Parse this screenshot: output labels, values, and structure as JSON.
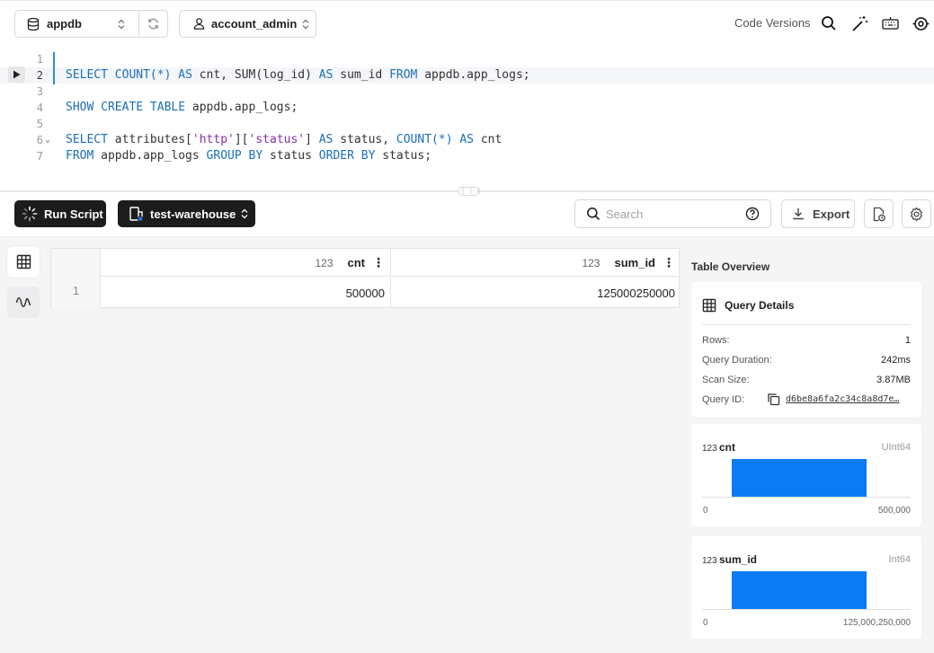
{
  "toolbar": {
    "database": "appdb",
    "user": "account_admin",
    "code_versions": "Code Versions"
  },
  "editor": {
    "lines": [
      {
        "num": "1"
      },
      {
        "num": "2"
      },
      {
        "num": "3"
      },
      {
        "num": "4"
      },
      {
        "num": "5"
      },
      {
        "num": "6"
      },
      {
        "num": "7"
      }
    ],
    "tokens": {
      "l2": [
        "SELECT",
        " COUNT(*) ",
        "AS",
        " cnt, SUM(log_id) ",
        "AS",
        " sum_id ",
        "FROM",
        " appdb.app_logs;"
      ],
      "l4": [
        "SHOW CREATE TABLE",
        " appdb.app_logs;"
      ],
      "l6": [
        "SELECT",
        " attributes[",
        "'http'",
        "][",
        "'status'",
        "] ",
        "AS",
        " status, ",
        "COUNT(*)",
        " ",
        "AS",
        " cnt"
      ],
      "l7": [
        "FROM",
        " appdb.app_logs ",
        "GROUP BY",
        " status ",
        "ORDER BY",
        " status;"
      ]
    }
  },
  "actions": {
    "run_script": "Run Script",
    "warehouse": "test-warehouse",
    "search_placeholder": "Search",
    "export": "Export"
  },
  "grid": {
    "columns": [
      {
        "type": "123",
        "name": "cnt"
      },
      {
        "type": "123",
        "name": "sum_id"
      }
    ],
    "rows": [
      {
        "num": "1",
        "cnt": "500000",
        "sum_id": "125000250000"
      }
    ]
  },
  "overview": {
    "title": "Table Overview",
    "query_details": {
      "title": "Query Details",
      "rows_label": "Rows:",
      "rows_value": "1",
      "duration_label": "Query Duration:",
      "duration_value": "242ms",
      "scan_label": "Scan Size:",
      "scan_value": "3.87MB",
      "qid_label": "Query ID:",
      "qid_value": "d6be8a6fa2c34c8a8d7e…"
    },
    "columns": [
      {
        "type": "123",
        "name": "cnt",
        "dtype": "UInt64",
        "min": "0",
        "max": "500,000"
      },
      {
        "type": "123",
        "name": "sum_id",
        "dtype": "Int64",
        "min": "0",
        "max": "125,000,250,000"
      }
    ]
  },
  "colors": {
    "accent": "#0a7bf5",
    "keyword": "#1a6fb8",
    "string": "#8a2ba8",
    "dark_button": "#1c1c1c"
  }
}
